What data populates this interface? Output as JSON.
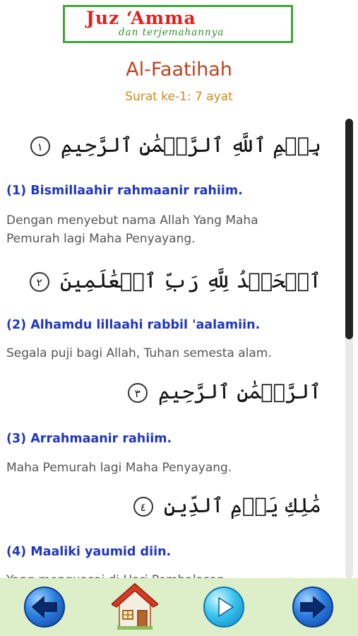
{
  "app": {
    "logo_title": "Juz ‘Amma",
    "logo_subtitle": "dan terjemahannya"
  },
  "surah": {
    "name": "Al-Faatihah",
    "subtitle": "Surat ke-1: 7 ayat"
  },
  "ayahs": [
    {
      "arabic": "بِسۡمِ ٱللَّهِ ٱلرَّحۡمَٰنِ ٱلرَّحِيمِ",
      "marker": "١",
      "latin": "(1) Bismillaahir rahmaanir rahiim.",
      "translation": "Dengan menyebut nama Allah Yang Maha Pemurah lagi Maha Penyayang."
    },
    {
      "arabic": "ٱلۡحَمۡدُ لِلَّهِ رَبِّ ٱلۡعَٰلَمِينَ",
      "marker": "٢",
      "latin": "(2) Alhamdu lillaahi rabbil 'aalamiin.",
      "translation": "Segala puji bagi Allah, Tuhan semesta alam."
    },
    {
      "arabic": "ٱلرَّحۡمَٰنِ ٱلرَّحِيمِ",
      "marker": "٣",
      "latin": "(3) Arrahmaanir rahiim.",
      "translation": "Maha Pemurah lagi Maha Penyayang."
    },
    {
      "arabic": "مَٰلِكِ يَوۡمِ ٱلدِّينِ",
      "marker": "٤",
      "latin": "(4) Maaliki yaumid diin.",
      "translation": "Yang menguasai di Hari Pembalasan."
    }
  ],
  "scroll": {
    "position_fraction": 0.0,
    "visible_fraction": 0.48
  },
  "nav": {
    "buttons": [
      "previous-button",
      "home-button",
      "play-button",
      "next-button"
    ]
  },
  "colors": {
    "title": "#c0441f",
    "subtitle": "#cc8a1e",
    "latin": "#1f36c0",
    "translation": "#555555",
    "navbar": "#dcefc9",
    "logo_border": "#3fa63a",
    "logo_text": "#e0201c"
  }
}
